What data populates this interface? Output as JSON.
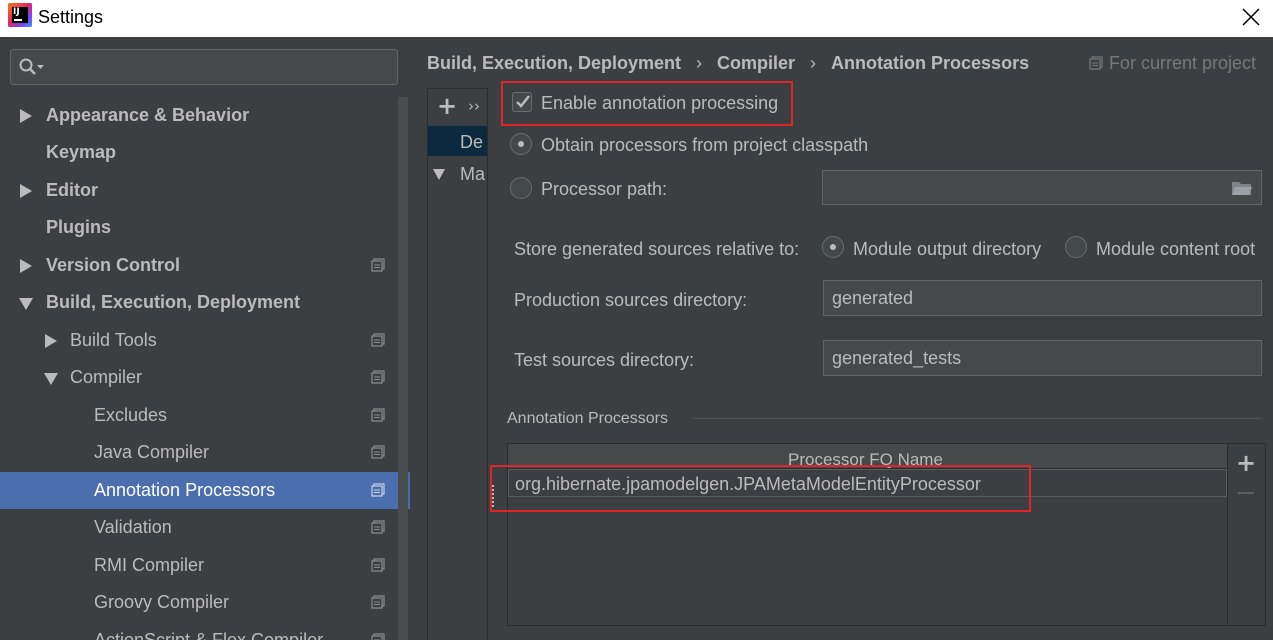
{
  "window": {
    "title": "Settings"
  },
  "sidebar": {
    "search": {
      "placeholder": "",
      "value": ""
    },
    "items": [
      {
        "label": "Appearance & Behavior"
      },
      {
        "label": "Keymap"
      },
      {
        "label": "Editor"
      },
      {
        "label": "Plugins"
      },
      {
        "label": "Version Control"
      },
      {
        "label": "Build, Execution, Deployment"
      },
      {
        "label": "Build Tools"
      },
      {
        "label": "Compiler"
      },
      {
        "label": "Excludes"
      },
      {
        "label": "Java Compiler"
      },
      {
        "label": "Annotation Processors"
      },
      {
        "label": "Validation"
      },
      {
        "label": "RMI Compiler"
      },
      {
        "label": "Groovy Compiler"
      },
      {
        "label": "ActionScript & Flex Compiler"
      }
    ],
    "selected": "Annotation Processors"
  },
  "breadcrumb": {
    "items": [
      "Build, Execution, Deployment",
      "Compiler",
      "Annotation Processors"
    ],
    "separator": "›",
    "scope": "For current project"
  },
  "profiles": {
    "add_label": "+",
    "more_label": "››",
    "default_label": "De",
    "maven_label": "Ma"
  },
  "settings": {
    "enable_annotation_processing": {
      "label": "Enable annotation processing",
      "checked": true
    },
    "obtain_from_classpath": {
      "label": "Obtain processors from project classpath",
      "selected": true
    },
    "processor_path": {
      "label": "Processor path:",
      "value": ""
    },
    "store_generated_label": "Store generated sources relative to:",
    "module_output": {
      "label": "Module output directory",
      "selected": true
    },
    "module_content_root": {
      "label": "Module content root",
      "selected": false
    },
    "production_sources": {
      "label": "Production sources directory:",
      "value": "generated"
    },
    "test_sources": {
      "label": "Test sources directory:",
      "value": "generated_tests"
    }
  },
  "annotation_processors": {
    "section_title": "Annotation Processors",
    "column_header": "Processor FQ Name",
    "rows": [
      "org.hibernate.jpamodelgen.JPAMetaModelEntityProcessor"
    ],
    "add_label": "+"
  },
  "colors": {
    "background": "#3c3f41",
    "selection": "#4b6eaf",
    "highlight_box": "#e0242c",
    "text": "#bbbbbb"
  }
}
